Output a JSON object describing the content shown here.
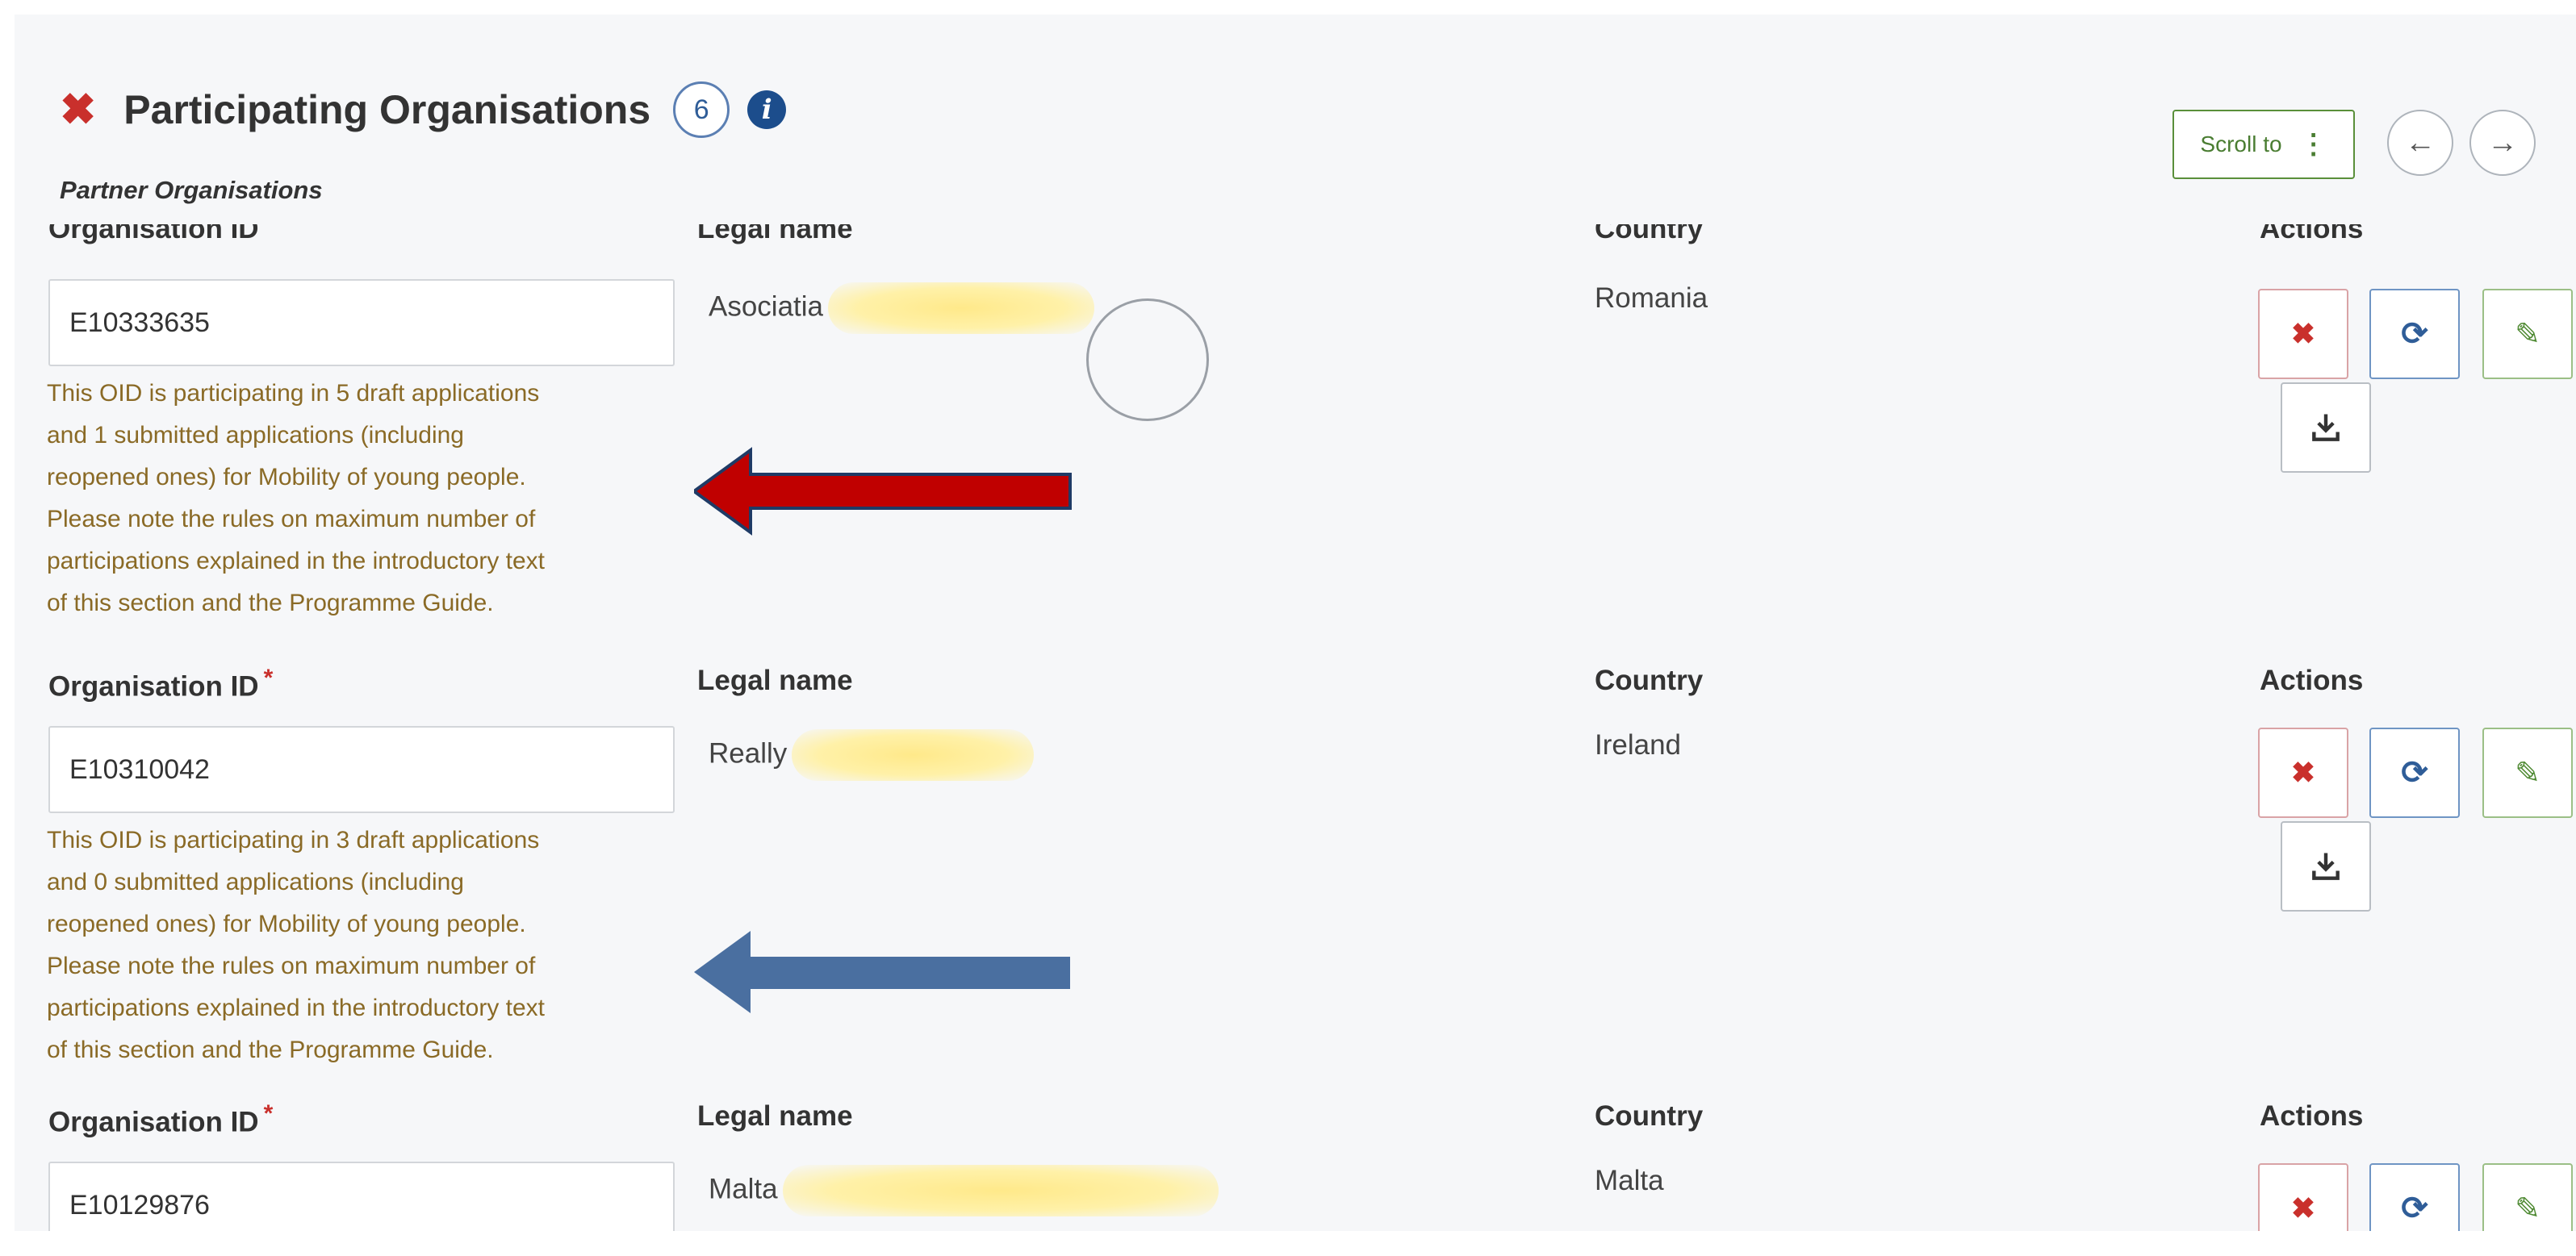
{
  "header": {
    "title": "Participating Organisations",
    "count": "6",
    "close_icon": "close-icon",
    "info_icon": "info-icon"
  },
  "subheading": "Partner Organisations",
  "toolbar": {
    "scroll_to_label": "Scroll to",
    "scroll_to_icon": "vertical-dots-icon",
    "prev_icon": "arrow-left-icon",
    "next_icon": "arrow-right-icon"
  },
  "columns": {
    "organisation_id": "Organisation ID",
    "legal_name": "Legal name",
    "country": "Country",
    "actions": "Actions"
  },
  "organisations": [
    {
      "oid": "E10333635",
      "legal_name": "Asociatia",
      "country": "Romania",
      "warning_lines": [
        "This OID is participating in 5 draft applications",
        "and 1 submitted applications (including",
        "reopened ones) for Mobility of young people.",
        "Please note the rules on maximum number of",
        "participations explained in the introductory text",
        "of this section and the Programme Guide."
      ]
    },
    {
      "oid": "E10310042",
      "legal_name": "Really",
      "country": "Ireland",
      "warning_lines": [
        "This OID is participating in 3 draft applications",
        "and 0 submitted applications (including",
        "reopened ones) for Mobility of young people.",
        "Please note the rules on maximum number of",
        "participations explained in the introductory text",
        "of this section and the Programme Guide."
      ]
    },
    {
      "oid": "E10129876",
      "legal_name": "Malta",
      "country": "Malta",
      "warning_lines": []
    }
  ],
  "actions": {
    "delete_icon": "close-icon",
    "refresh_icon": "refresh-icon",
    "edit_icon": "pencil-icon",
    "download_icon": "download-icon"
  },
  "annotations": {
    "red_arrow_color": "#c00000",
    "blue_arrow_color": "#4a6fa0"
  }
}
